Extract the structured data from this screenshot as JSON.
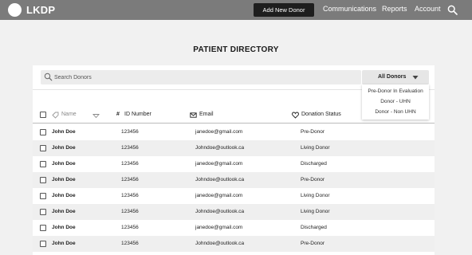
{
  "header": {
    "brand": "LKDP",
    "add_donor_label": "Add New Donor",
    "nav": [
      "Communications",
      "Reports",
      "Account"
    ]
  },
  "page": {
    "title": "PATIENT DIRECTORY"
  },
  "search": {
    "placeholder": "Search Donors"
  },
  "filter": {
    "selected": "All Donors",
    "options": [
      "Pre-Donor In Evaluation",
      "Donor - UHN",
      "Donor - Non UHN"
    ]
  },
  "table": {
    "columns": [
      "Name",
      "ID Number",
      "Email",
      "Donation Status"
    ],
    "rows": [
      {
        "name": "John Doe",
        "id": "123456",
        "email": "janedoe@gmail.com",
        "status": "Pre-Donor"
      },
      {
        "name": "John Doe",
        "id": "123456",
        "email": "Johndoe@outlook.ca",
        "status": "Living Donor"
      },
      {
        "name": "John Doe",
        "id": "123456",
        "email": "janedoe@gmail.com",
        "status": "Discharged"
      },
      {
        "name": "John Doe",
        "id": "123456",
        "email": "Johndoe@outlook.ca",
        "status": "Pre-Donor"
      },
      {
        "name": "John Doe",
        "id": "123456",
        "email": "janedoe@gmail.com",
        "status": "Living Donor"
      },
      {
        "name": "John Doe",
        "id": "123456",
        "email": "Johndoe@outlook.ca",
        "status": "Living Donor"
      },
      {
        "name": "John Doe",
        "id": "123456",
        "email": "janedoe@gmail.com",
        "status": "Discharged"
      },
      {
        "name": "John Doe",
        "id": "123456",
        "email": "Johndoe@outlook.ca",
        "status": "Pre-Donor"
      }
    ]
  }
}
